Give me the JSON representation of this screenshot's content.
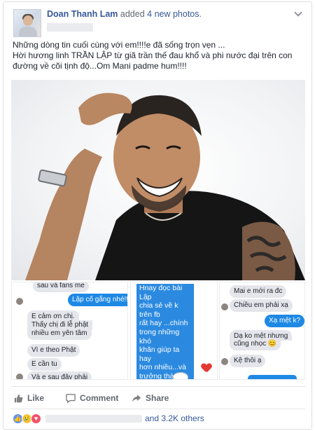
{
  "post": {
    "author": "Doan Thanh Lam",
    "verb": "added",
    "photos_link": "4 new photos",
    "status_line1": "Những dòng tin cuối cùng với em!!!!e đã sống trọn vẹn ...",
    "status_line2": "Hời hương linh TRẦN LẬP từ giã trần thế đau khổ và phi nước đại trên con đường về cõi tịnh độ...Om Mani padme hum!!!!"
  },
  "thumbs": {
    "t1": {
      "m1": "sau và fans me",
      "m2": "Lập cố gắng nhé!!!",
      "m3": "E cảm ơn chị.",
      "m4": "Thấy chị đi lễ phật",
      "m5": "nhiều em yên tâm",
      "m6": "Vì e theo Phật",
      "m7": "E cần tu",
      "m8": "Và e sau đây phải"
    },
    "t2": {
      "text": "Hnay đọc bài Lập\nchia sẻ về k trên fb\nrất hay ...chính\ntrong những khó\nkhăn giúp ta hay\nhơn nhiều...và\ntrưởng thành\ntrong phongba"
    },
    "t3": {
      "m1": "Mai e mới ra đc",
      "m2": "Chiều em phải xạ",
      "m3": "Xạ mệt k?",
      "m4": "Dạ ko mệt nhưng",
      "m5": "cũng nhọc 😊",
      "m6": "Kệ thôi ạ"
    }
  },
  "actions": {
    "like": "Like",
    "comment": "Comment",
    "share": "Share"
  },
  "reactions": {
    "others": "and 3.2K others"
  },
  "colors": {
    "link": "#365899",
    "messenger_blue": "#1e88e5",
    "like_blue": "#5890ff",
    "love_red": "#f25268"
  }
}
